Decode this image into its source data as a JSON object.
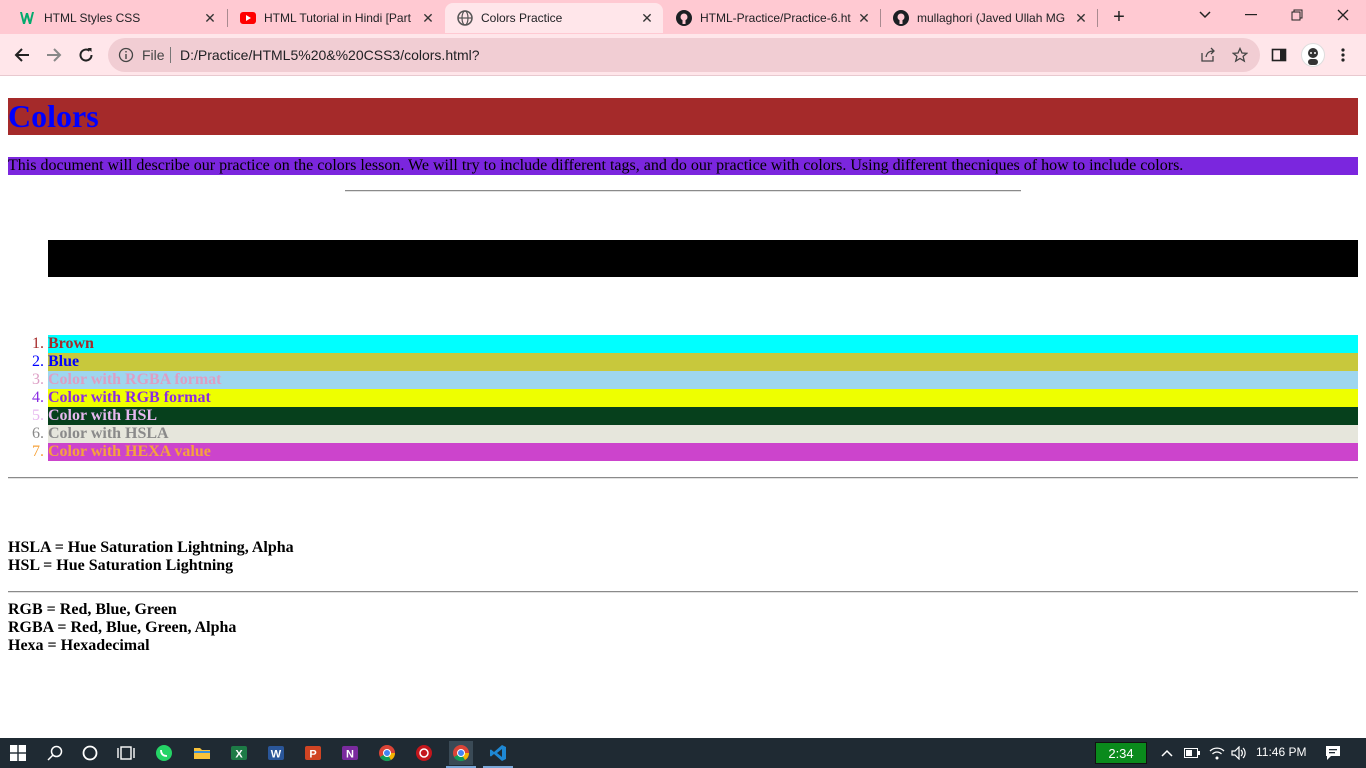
{
  "browser": {
    "tabs": [
      {
        "title": "HTML Styles CSS",
        "favicon": "w3schools-icon",
        "active": false
      },
      {
        "title": "HTML Tutorial in Hindi [Part",
        "favicon": "youtube-icon",
        "active": false
      },
      {
        "title": "Colors Practice",
        "favicon": "globe-icon",
        "active": true
      },
      {
        "title": "HTML-Practice/Practice-6.ht",
        "favicon": "github-icon",
        "active": false
      },
      {
        "title": "mullaghori (Javed Ullah MG",
        "favicon": "github-icon",
        "active": false
      }
    ],
    "address": {
      "scheme_label": "File",
      "url": "D:/Practice/HTML5%20&%20CSS3/colors.html?"
    }
  },
  "page": {
    "heading": "Colors",
    "intro": "This document will describe our practice on the colors lesson. We will try to include different tags, and do our practice with colors. Using different thecniques of how to include colors.",
    "list": [
      {
        "num": "1.",
        "label": "Brown",
        "bg": "#00ffff",
        "fg": "#a52a2a",
        "marker": "#a52a2a"
      },
      {
        "num": "2.",
        "label": "Blue",
        "bg": "#c8c83c",
        "fg": "#0000ff",
        "marker": "#0000ff"
      },
      {
        "num": "3.",
        "label": "Color with RGBA format",
        "bg": "#9ed6ef",
        "fg": "#dd9fc5",
        "marker": "#dd9fc5"
      },
      {
        "num": "4.",
        "label": "Color with RGB format",
        "bg": "#eeff00",
        "fg": "#8a2be2",
        "marker": "#8a2be2"
      },
      {
        "num": "5.",
        "label": "Color with HSL",
        "bg": "#06401c",
        "fg": "#e7b8ef",
        "marker": "#e7b8ef"
      },
      {
        "num": "6.",
        "label": "Color with HSLA",
        "bg": "#e6e6dc",
        "fg": "#8a8a8a",
        "marker": "#8a8a8a"
      },
      {
        "num": "7.",
        "label": "Color with HEXA value",
        "bg": "#cc44cc",
        "fg": "#f6a33c",
        "marker": "#f6a33c"
      }
    ],
    "notes_hsl": [
      "HSLA = Hue Saturation Lightning, Alpha",
      "HSL = Hue Saturation Lightning"
    ],
    "notes_rgb": [
      "RGB = Red, Blue, Green",
      "RGBA = Red, Blue, Green, Alpha",
      "Hexa = Hexadecimal"
    ]
  },
  "taskbar": {
    "apps": [
      "windows-start-icon",
      "search-icon",
      "cortana-icon",
      "task-view-icon",
      "whatsapp-icon",
      "file-explorer-icon",
      "excel-icon",
      "word-icon",
      "powerpoint-icon",
      "onenote-icon",
      "chrome-icon",
      "davinci-icon",
      "chrome-active-icon",
      "vscode-icon"
    ],
    "timer": "2:34",
    "clock": "11:46 PM"
  }
}
